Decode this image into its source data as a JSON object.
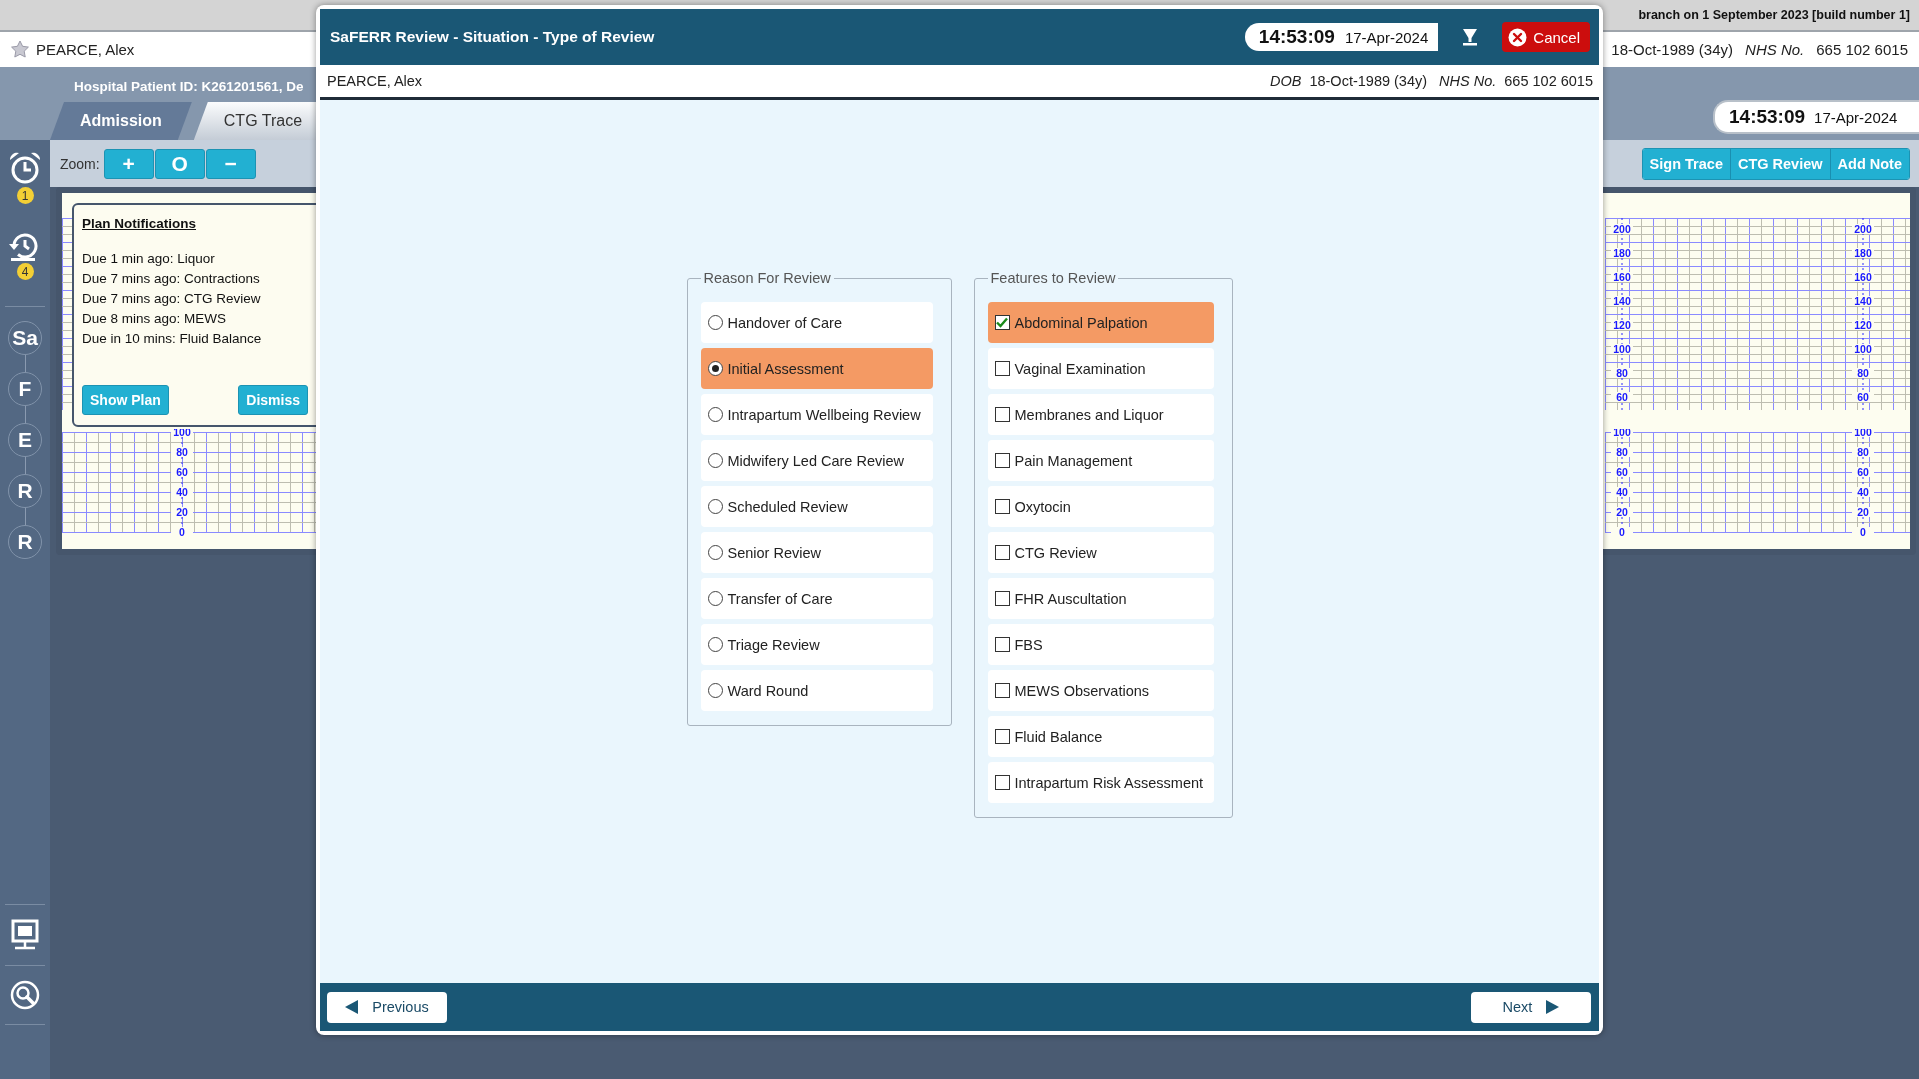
{
  "build_info": "branch on 1 September 2023 [build number 1]",
  "patient_bar": {
    "name": "PEARCE, Alex",
    "dob": "18-Oct-1989 (34y)",
    "nhs_label": "NHS No.",
    "nhs_number": "665 102 6015"
  },
  "header": {
    "patient_id": "Hospital Patient ID: K261201561, De",
    "time": "14:53:09",
    "date": "17-Apr-2024"
  },
  "tabs": [
    {
      "label": "Admission",
      "selected": false
    },
    {
      "label": "CTG Trace",
      "selected": true
    }
  ],
  "rail": {
    "alerts": [
      {
        "kind": "alarm",
        "count": "1"
      },
      {
        "kind": "history",
        "count": "4"
      }
    ],
    "steps": [
      "Sa",
      "F",
      "E",
      "R",
      "R"
    ]
  },
  "toolbar": {
    "zoom_label": "Zoom:",
    "zoom_buttons": [
      "+",
      "O",
      "−"
    ],
    "actions": [
      "Sign Trace",
      "CTG Review",
      "Add Note"
    ]
  },
  "chart_left": {
    "toco_scale": [
      "100",
      "80",
      "60",
      "40",
      "20",
      "0"
    ]
  },
  "chart_right": {
    "fhr_scales": [
      [
        "200",
        "180",
        "160",
        "140",
        "120",
        "100",
        "80",
        "60"
      ],
      [
        "200",
        "180",
        "160",
        "140",
        "120",
        "100",
        "80",
        "60"
      ]
    ],
    "toco_scales": [
      [
        "100",
        "80",
        "60",
        "40",
        "20",
        "0"
      ],
      [
        "100",
        "80",
        "60",
        "40",
        "20",
        "0"
      ]
    ]
  },
  "plan_notifications": {
    "title": "Plan Notifications",
    "items": [
      "Due 1 min ago: Liquor",
      "Due 7 mins ago: Contractions",
      "Due 7 mins ago: CTG Review",
      "Due 8 mins ago: MEWS",
      "Due in 10 mins: Fluid Balance"
    ],
    "buttons": [
      "Show Plan",
      "Dismiss"
    ]
  },
  "dialog": {
    "title": "SaFERR Review - Situation - Type of Review",
    "time": "14:53:09",
    "date": "17-Apr-2024",
    "cancel": "Cancel",
    "patient": {
      "name": "PEARCE, Alex",
      "dob_label": "DOB",
      "dob": "18-Oct-1989 (34y)",
      "nhs_label": "NHS No.",
      "nhs_number": "665 102 6015"
    },
    "reason": {
      "legend": "Reason For Review",
      "options": [
        {
          "label": "Handover of Care",
          "selected": false
        },
        {
          "label": "Initial Assessment",
          "selected": true
        },
        {
          "label": "Intrapartum Wellbeing Review",
          "selected": false
        },
        {
          "label": "Midwifery Led Care Review",
          "selected": false
        },
        {
          "label": "Scheduled Review",
          "selected": false
        },
        {
          "label": "Senior Review",
          "selected": false
        },
        {
          "label": "Transfer of Care",
          "selected": false
        },
        {
          "label": "Triage Review",
          "selected": false
        },
        {
          "label": "Ward Round",
          "selected": false
        }
      ]
    },
    "features": {
      "legend": "Features to Review",
      "options": [
        {
          "label": "Abdominal Palpation",
          "checked": true
        },
        {
          "label": "Vaginal Examination",
          "checked": false
        },
        {
          "label": "Membranes and Liquor",
          "checked": false
        },
        {
          "label": "Pain Management",
          "checked": false
        },
        {
          "label": "Oxytocin",
          "checked": false
        },
        {
          "label": "CTG Review",
          "checked": false
        },
        {
          "label": "FHR Auscultation",
          "checked": false
        },
        {
          "label": "FBS",
          "checked": false
        },
        {
          "label": "MEWS Observations",
          "checked": false
        },
        {
          "label": "Fluid Balance",
          "checked": false
        },
        {
          "label": "Intrapartum Risk Assessment",
          "checked": false
        }
      ]
    },
    "previous": "Previous",
    "next": "Next"
  }
}
